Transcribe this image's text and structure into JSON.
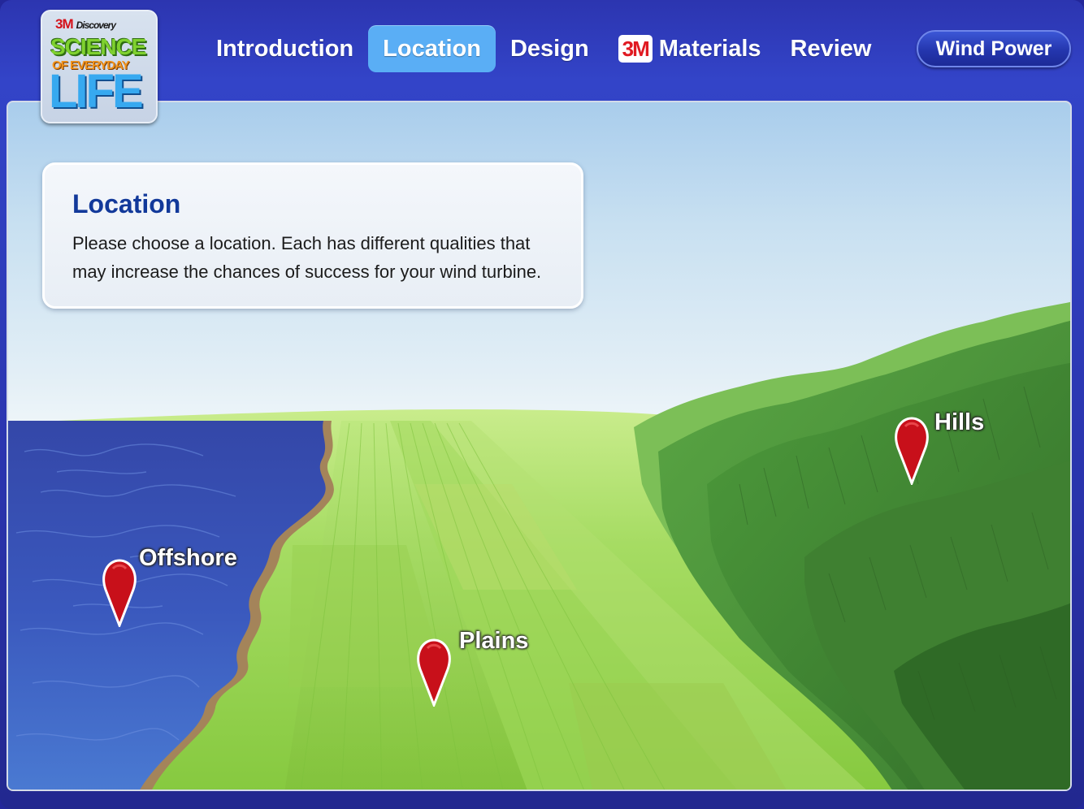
{
  "logo": {
    "brand_3m": "3M",
    "brand_discovery": "Discovery",
    "line1": "SCIENCE",
    "line2": "OF EVERYDAY",
    "line3": "LIFE"
  },
  "nav": {
    "tabs": [
      {
        "label": "Introduction",
        "active": false
      },
      {
        "label": "Location",
        "active": true
      },
      {
        "label": "Design",
        "active": false
      },
      {
        "badge": "3M",
        "label": "Materials",
        "active": false
      },
      {
        "label": "Review",
        "active": false
      }
    ],
    "wind_power_label": "Wind Power"
  },
  "info": {
    "title": "Location",
    "text": "Please choose a location. Each has different qualities that may increase the chances of success for your wind turbine."
  },
  "locations": {
    "offshore": "Offshore",
    "plains": "Plains",
    "hills": "Hills"
  },
  "colors": {
    "frame": "#2a34ad",
    "active_tab": "#5aaef5",
    "title_blue": "#12399a",
    "marker_red": "#c8101a",
    "water": "#3b5cc4",
    "grass": "#8fd24a",
    "hills": "#4f9a3c"
  }
}
